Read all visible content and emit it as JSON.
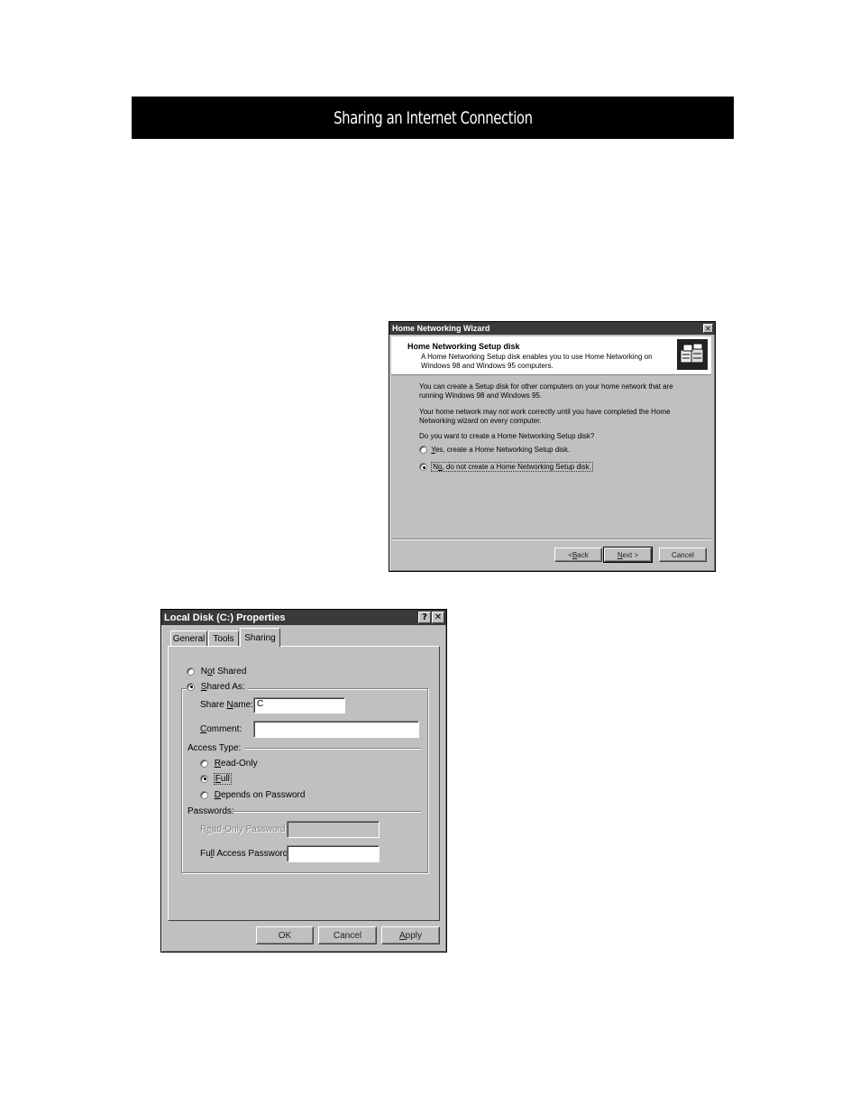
{
  "header": {
    "title": "Sharing an Internet Connection"
  },
  "wizard": {
    "window_title": "Home Networking Wizard",
    "close_icon": "close-icon",
    "banner_title": "Home Networking Setup disk",
    "banner_desc_line1": "A Home Networking Setup disk enables you to use Home Networking on",
    "banner_desc_line2": "Windows 98 and Windows 95 computers.",
    "banner_icon": "networked-computers-icon",
    "para1_line1": "You can create a Setup disk for other computers on your home network that are",
    "para1_line2": "running Windows 98 and Windows 95.",
    "para2_line1": "Your home network may not work correctly until you have completed the Home",
    "para2_line2": "Networking wizard on every computer.",
    "question": "Do you want to create a Home Networking Setup disk?",
    "options": [
      {
        "accel": "Y",
        "rest": "es, create a Home Networking Setup disk.",
        "checked": false
      },
      {
        "pre": "N",
        "accel": "o",
        "rest": ", do not create a Home Networking Setup disk.",
        "checked": true
      }
    ],
    "buttons": {
      "back_prefix": "< ",
      "back_accel": "B",
      "back_rest": "ack",
      "next_accel": "N",
      "next_rest": "ext >",
      "cancel": "Cancel"
    }
  },
  "properties": {
    "window_title": "Local Disk (C:) Properties",
    "help_label": "?",
    "close_label": "✕",
    "tabs": [
      "General",
      "Tools",
      "Sharing"
    ],
    "active_tab": "Sharing",
    "not_shared": {
      "pre": "N",
      "accel": "o",
      "rest": "t Shared",
      "checked": false
    },
    "shared_as": {
      "accel": "S",
      "rest": "hared As:",
      "checked": true
    },
    "share_name": {
      "pre": "Share ",
      "accel": "N",
      "rest": "ame:",
      "value": "C"
    },
    "comment": {
      "accel": "C",
      "rest": "omment:",
      "value": ""
    },
    "access_type_label": "Access Type:",
    "access_options": [
      {
        "accel": "R",
        "rest": "ead-Only",
        "checked": false
      },
      {
        "accel": "F",
        "rest": "ull",
        "checked": true
      },
      {
        "accel": "D",
        "rest": "epends on Password",
        "checked": false
      }
    ],
    "passwords_label": "Passwords:",
    "read_only_password": {
      "pre": "R",
      "accel": "e",
      "rest": "ad-Only Password:",
      "value": "",
      "enabled": false
    },
    "full_access_password": {
      "pre": "Fu",
      "accel": "l",
      "rest": "l Access Password:",
      "value": "",
      "enabled": true
    },
    "buttons": {
      "ok": "OK",
      "cancel": "Cancel",
      "apply_accel": "A",
      "apply_rest": "pply"
    }
  }
}
